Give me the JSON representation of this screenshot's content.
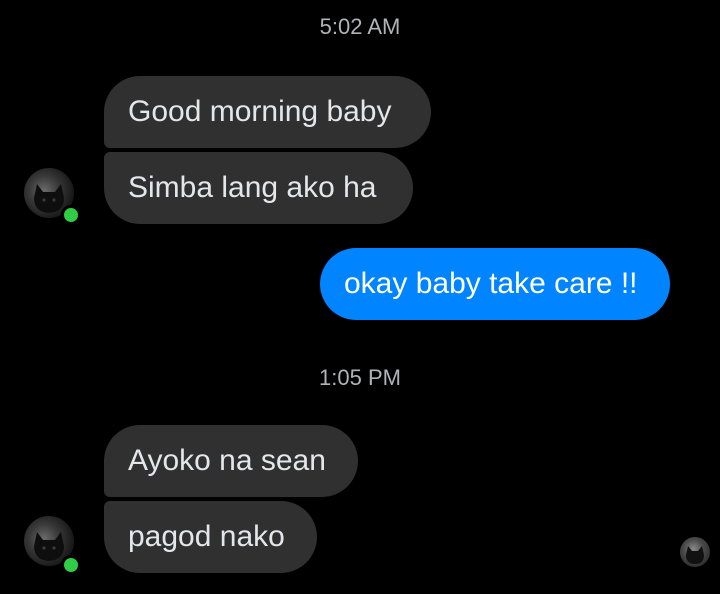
{
  "conversation": {
    "timestamp_1": "5:02 AM",
    "timestamp_2": "1:05 PM",
    "messages": [
      {
        "text": "Good morning baby"
      },
      {
        "text": "Simba lang ako ha"
      },
      {
        "text": "okay baby take care !!"
      },
      {
        "text": "Ayoko na sean"
      },
      {
        "text": "pagod nako"
      }
    ]
  },
  "contact": {
    "avatar_icon": "black-cat-avatar-icon",
    "status": "online",
    "status_color": "#31cc46"
  },
  "colors": {
    "background": "#000000",
    "incoming_bubble": "#303030",
    "outgoing_bubble": "#0084ff",
    "timestamp_text": "#b0b3b8"
  }
}
